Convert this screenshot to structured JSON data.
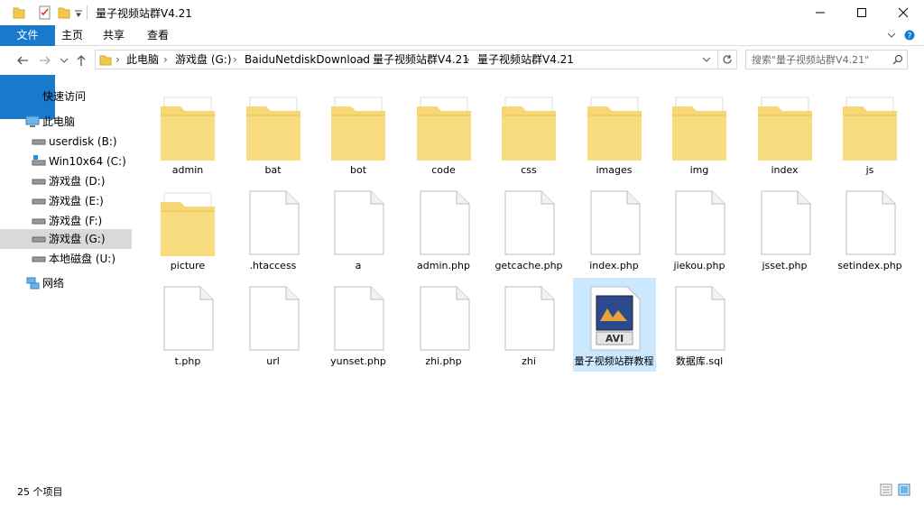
{
  "window": {
    "title": "量子视频站群V4.21"
  },
  "ribbon": {
    "tabs": [
      "文件",
      "主页",
      "共享",
      "查看"
    ]
  },
  "address": {
    "segments": [
      "此电脑",
      "游戏盘 (G:)",
      "BaiduNetdiskDownload",
      "量子视频站群V4.21",
      "量子视频站群V4.21"
    ],
    "separator": "›"
  },
  "search": {
    "placeholder": "搜索\"量子视频站群V4.21\""
  },
  "nav": {
    "items": [
      {
        "label": "快速访问",
        "icon": "star-icon"
      },
      {
        "label": "此电脑",
        "icon": "computer-icon"
      },
      {
        "label": "userdisk (B:)",
        "icon": "drive-icon"
      },
      {
        "label": "Win10x64 (C:)",
        "icon": "system-drive-icon"
      },
      {
        "label": "游戏盘 (D:)",
        "icon": "drive-icon"
      },
      {
        "label": "游戏盘 (E:)",
        "icon": "drive-icon"
      },
      {
        "label": "游戏盘 (F:)",
        "icon": "drive-icon"
      },
      {
        "label": "游戏盘 (G:)",
        "icon": "drive-icon"
      },
      {
        "label": "本地磁盘 (U:)",
        "icon": "drive-icon"
      },
      {
        "label": "网络",
        "icon": "network-icon"
      }
    ]
  },
  "files": [
    {
      "name": "admin",
      "type": "folder"
    },
    {
      "name": "bat",
      "type": "folder"
    },
    {
      "name": "bot",
      "type": "folder"
    },
    {
      "name": "code",
      "type": "folder"
    },
    {
      "name": "css",
      "type": "folder"
    },
    {
      "name": "images",
      "type": "folder"
    },
    {
      "name": "img",
      "type": "folder"
    },
    {
      "name": "index",
      "type": "folder"
    },
    {
      "name": "js",
      "type": "folder"
    },
    {
      "name": "picture",
      "type": "folder"
    },
    {
      "name": ".htaccess",
      "type": "file"
    },
    {
      "name": "a",
      "type": "file"
    },
    {
      "name": "admin.php",
      "type": "file"
    },
    {
      "name": "getcache.php",
      "type": "file"
    },
    {
      "name": "index.php",
      "type": "file"
    },
    {
      "name": "jiekou.php",
      "type": "file"
    },
    {
      "name": "jsset.php",
      "type": "file"
    },
    {
      "name": "setindex.php",
      "type": "file"
    },
    {
      "name": "t.php",
      "type": "file"
    },
    {
      "name": "url",
      "type": "file"
    },
    {
      "name": "yunset.php",
      "type": "file"
    },
    {
      "name": "zhi.php",
      "type": "file"
    },
    {
      "name": "zhi",
      "type": "file"
    },
    {
      "name": "量子视频站群教程",
      "type": "video"
    },
    {
      "name": "数据库.sql",
      "type": "file"
    }
  ],
  "status": {
    "count": "25 个项目"
  },
  "colors": {
    "accent": "#1979ca",
    "folder": "#f7d774",
    "selection": "#cce8ff"
  }
}
